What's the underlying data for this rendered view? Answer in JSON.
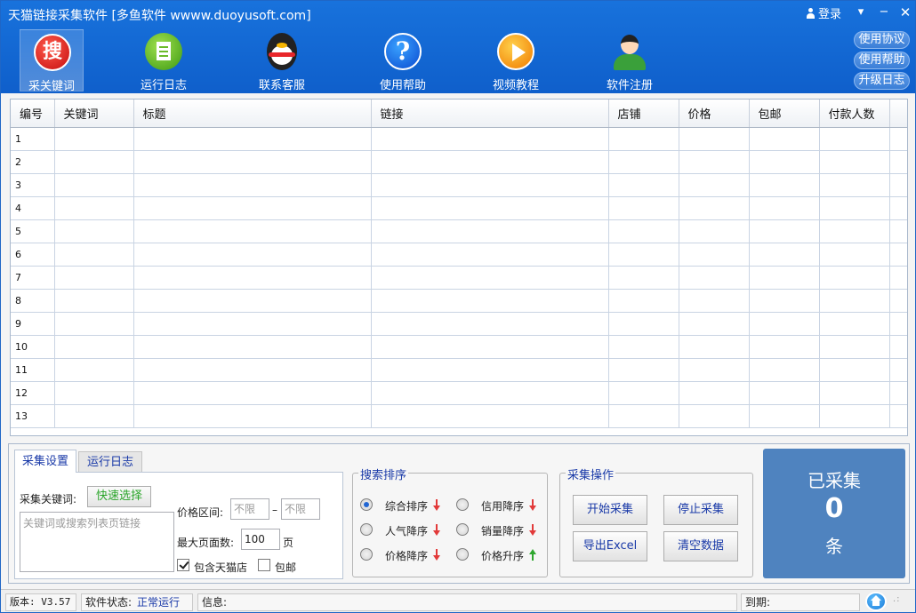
{
  "window": {
    "title": "天猫链接采集软件  [多鱼软件 wwww.duoyusoft.com]",
    "login": "登录",
    "menu_glyph": "▾",
    "min_glyph": "−",
    "close_glyph": "✕"
  },
  "toolbar": {
    "items": [
      {
        "label": "采关键词",
        "icon": "search-badge-icon",
        "glyph": "搜"
      },
      {
        "label": "运行日志",
        "icon": "log-document-icon"
      },
      {
        "label": "联系客服",
        "icon": "qq-penguin-icon"
      },
      {
        "label": "使用帮助",
        "icon": "question-icon",
        "glyph": "?"
      },
      {
        "label": "视频教程",
        "icon": "play-icon"
      },
      {
        "label": "软件注册",
        "icon": "user-icon"
      }
    ]
  },
  "side_links": [
    "使用协议",
    "使用帮助",
    "升级日志"
  ],
  "grid": {
    "columns": [
      "编号",
      "关键词",
      "标题",
      "链接",
      "店铺",
      "价格",
      "包邮",
      "付款人数"
    ],
    "rows": [
      "1",
      "2",
      "3",
      "4",
      "5",
      "6",
      "7",
      "8",
      "9",
      "10",
      "11",
      "12",
      "13"
    ]
  },
  "tabs": [
    "采集设置",
    "运行日志"
  ],
  "settings": {
    "keyword_label": "采集关键词:",
    "quick_select": "快速选择",
    "keyword_placeholder": "关键词或搜索列表页链接",
    "price_label": "价格区间:",
    "price_min_placeholder": "不限",
    "price_max_placeholder": "不限",
    "price_dash": "–",
    "max_page_label": "最大页面数:",
    "max_page_value": "100",
    "page_unit": "页",
    "tmall_label": "包含天猫店",
    "tmall_checked": true,
    "free_shipping_label": "包邮",
    "free_shipping_checked": false
  },
  "sort": {
    "title": "搜索排序",
    "options": [
      {
        "label": "综合排序",
        "dir": "down",
        "selected": true
      },
      {
        "label": "信用降序",
        "dir": "down",
        "selected": false
      },
      {
        "label": "人气降序",
        "dir": "down",
        "selected": false
      },
      {
        "label": "销量降序",
        "dir": "down",
        "selected": false
      },
      {
        "label": "价格降序",
        "dir": "down",
        "selected": false
      },
      {
        "label": "价格升序",
        "dir": "up",
        "selected": false
      }
    ]
  },
  "operations": {
    "title": "采集操作",
    "buttons": [
      "开始采集",
      "停止采集",
      "导出Excel",
      "清空数据"
    ]
  },
  "collected": {
    "label": "已采集",
    "value": "0",
    "unit": "条"
  },
  "status": {
    "version": "版本: V3.57",
    "state_label": "软件状态:",
    "state_value": "正常运行",
    "info_label": "信息:",
    "expire_label": "到期:",
    "grip": ".:"
  },
  "colors": {
    "titlebar": "#1872dc",
    "count_box": "#4f83bf",
    "link_blue": "#1a3aa8",
    "arrow_down": "#e23a3a",
    "arrow_up": "#2ea72e"
  }
}
